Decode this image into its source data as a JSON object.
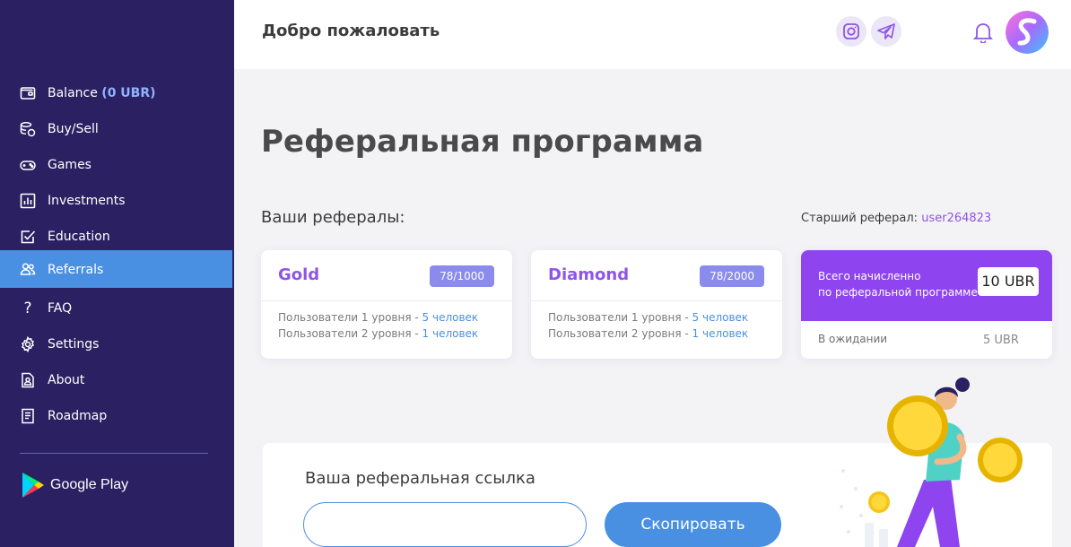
{
  "header": {
    "welcome": "Добро пожаловать",
    "social": [
      {
        "icon": "instagram-icon"
      },
      {
        "icon": "telegram-icon"
      }
    ],
    "notifications_icon": "bell-icon",
    "avatar_icon": "avatar-logo-s"
  },
  "sidebar": {
    "items": [
      {
        "label": "Balance",
        "extra": "(0 UBR)",
        "icon": "wallet-icon",
        "active": false
      },
      {
        "label": "Buy/Sell",
        "icon": "coins-icon",
        "active": false
      },
      {
        "label": "Games",
        "icon": "gamepad-icon",
        "active": false
      },
      {
        "label": "Investments",
        "icon": "chart-icon",
        "active": false
      },
      {
        "label": "Education",
        "icon": "checkbox-icon",
        "active": false
      },
      {
        "label": "Referrals",
        "icon": "users-icon",
        "active": true
      },
      {
        "label": "FAQ",
        "icon": "question-icon",
        "active": false
      },
      {
        "label": "Settings",
        "icon": "gear-icon",
        "active": false
      },
      {
        "label": "About",
        "icon": "document-person-icon",
        "active": false
      },
      {
        "label": "Roadmap",
        "icon": "list-icon",
        "active": false
      }
    ],
    "store_label": "Google Play",
    "store_icon": "google-play-icon"
  },
  "main": {
    "title": "Реферальная программа",
    "referrals_title": "Ваши рефералы:",
    "senior_label": "Старший реферал:",
    "senior_user": "user264823",
    "cards": [
      {
        "title": "Gold",
        "badge": "78/1000",
        "line1_label": "Пользователи 1 уровня -",
        "line1_count": "5 человек",
        "line2_label": "Пользователи 2 уровня -",
        "line2_count": "1 человек"
      },
      {
        "title": "Diamond",
        "badge": "78/2000",
        "line1_label": "Пользователи 1 уровня -",
        "line1_count": "5 человек",
        "line2_label": "Пользователи 2 уровня -",
        "line2_count": "1 человек"
      }
    ],
    "total": {
      "label_line1": "Всего начисленно",
      "label_line2": "по реферальной программе",
      "value": "10 UBR",
      "pending_label": "В ожидании",
      "pending_value": "5 UBR"
    },
    "link": {
      "title": "Ваша реферальная ссылка",
      "value": "",
      "placeholder": "",
      "copy_label": "Скопировать"
    }
  },
  "colors": {
    "sidebar_bg": "#2b2162",
    "active_item": "#4a90e2",
    "accent_purple": "#8e55e6",
    "total_bg": "#8e44ef",
    "badge_bg": "#8b8bee",
    "link_blue": "#4a90e2"
  }
}
